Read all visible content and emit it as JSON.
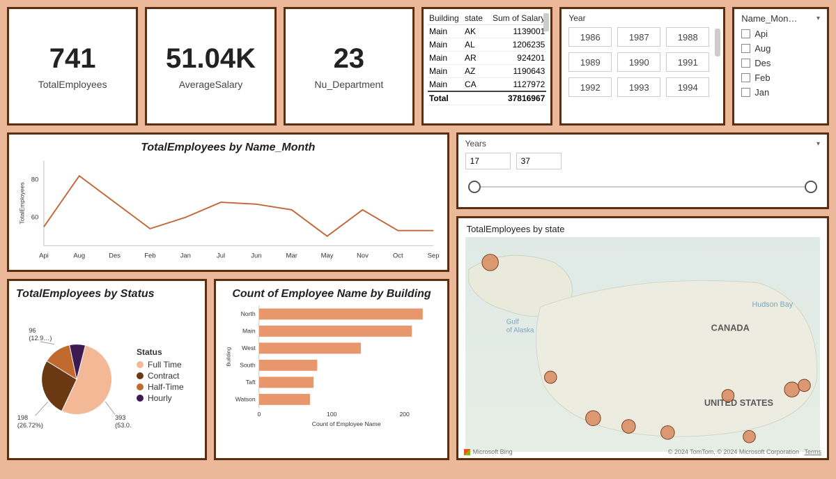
{
  "kpis": {
    "total_employees": {
      "value": "741",
      "label": "TotalEmployees"
    },
    "avg_salary": {
      "value": "51.04K",
      "label": "AverageSalary"
    },
    "nu_dept": {
      "value": "23",
      "label": "Nu_Department"
    }
  },
  "salary_table": {
    "cols": [
      "Building",
      "state",
      "Sum of Salary"
    ],
    "rows": [
      {
        "b": "Main",
        "s": "AK",
        "v": "1139001"
      },
      {
        "b": "Main",
        "s": "AL",
        "v": "1206235"
      },
      {
        "b": "Main",
        "s": "AR",
        "v": "924201"
      },
      {
        "b": "Main",
        "s": "AZ",
        "v": "1190643"
      },
      {
        "b": "Main",
        "s": "CA",
        "v": "1127972"
      }
    ],
    "total_label": "Total",
    "total_value": "37816967"
  },
  "year_slicer": {
    "title": "Year",
    "years": [
      "1986",
      "1987",
      "1988",
      "1989",
      "1990",
      "1991",
      "1992",
      "1993",
      "1994"
    ]
  },
  "month_slicer": {
    "title": "Name_Mon…",
    "items": [
      "Api",
      "Aug",
      "Des",
      "Feb",
      "Jan"
    ]
  },
  "range_slicer": {
    "title": "Years",
    "from": "17",
    "to": "37"
  },
  "line_chart_title": "TotalEmployees by Name_Month",
  "pie_title": "TotalEmployees by Status",
  "bar_title": "Count of Employee Name by Building",
  "map_title": "TotalEmployees by state",
  "map_attr_left": "Microsoft Bing",
  "map_attr_right": "© 2024 TomTom, © 2024 Microsoft Corporation",
  "map_terms": "Terms",
  "map_labels": {
    "canada": "CANADA",
    "us": "UNITED STATES",
    "gulf": "Gulf\nof Alaska",
    "hudson": "Hudson Bay"
  },
  "chart_data": [
    {
      "id": "line",
      "type": "line",
      "title": "TotalEmployees by Name_Month",
      "ylabel": "TotalEmployees",
      "categories": [
        "Api",
        "Aug",
        "Des",
        "Feb",
        "Jan",
        "Jul",
        "Jun",
        "Mar",
        "May",
        "Nov",
        "Oct",
        "Sep"
      ],
      "values": [
        55,
        82,
        68,
        54,
        60,
        68,
        67,
        64,
        50,
        64,
        53,
        53
      ],
      "yticks": [
        60,
        80
      ],
      "ylim": [
        45,
        90
      ]
    },
    {
      "id": "pie",
      "type": "pie",
      "title": "TotalEmployees by Status",
      "legend_title": "Status",
      "series": [
        {
          "name": "Full Time",
          "value": 393,
          "pct": "53.0…",
          "color": "#f3b896"
        },
        {
          "name": "Contract",
          "value": 198,
          "pct": "26.72%",
          "color": "#6a3913"
        },
        {
          "name": "Half-Time",
          "value": 96,
          "pct": "12.9…",
          "color": "#c16a2f"
        },
        {
          "name": "Hourly",
          "value": 54,
          "pct": "",
          "color": "#3e1a53"
        }
      ],
      "callouts": [
        {
          "text": "393\n(53.0…)"
        },
        {
          "text": "198\n(26.72%)"
        },
        {
          "text": "96\n(12.9…)"
        }
      ]
    },
    {
      "id": "bar",
      "type": "bar",
      "orientation": "h",
      "title": "Count of Employee Name by Building",
      "xlabel": "Count of Employee Name",
      "ylabel": "Building",
      "categories": [
        "North",
        "Main",
        "West",
        "South",
        "Taft",
        "Watson"
      ],
      "values": [
        225,
        210,
        140,
        80,
        75,
        70
      ],
      "xticks": [
        0,
        100,
        200
      ],
      "color": "#e8976c"
    },
    {
      "id": "map",
      "type": "map",
      "title": "TotalEmployees by state",
      "points": [
        {
          "label": "AK",
          "x": 0.07,
          "y": 0.1,
          "r": 12
        },
        {
          "label": "WA",
          "x": 0.24,
          "y": 0.66,
          "r": 9
        },
        {
          "label": "CA",
          "x": 0.36,
          "y": 0.86,
          "r": 11
        },
        {
          "label": "AZ",
          "x": 0.46,
          "y": 0.9,
          "r": 10
        },
        {
          "label": "TX",
          "x": 0.57,
          "y": 0.93,
          "r": 10
        },
        {
          "label": "IL",
          "x": 0.74,
          "y": 0.75,
          "r": 9
        },
        {
          "label": "NY",
          "x": 0.92,
          "y": 0.72,
          "r": 11
        },
        {
          "label": "MA",
          "x": 0.955,
          "y": 0.7,
          "r": 9
        },
        {
          "label": "FL",
          "x": 0.8,
          "y": 0.95,
          "r": 9
        }
      ]
    }
  ]
}
